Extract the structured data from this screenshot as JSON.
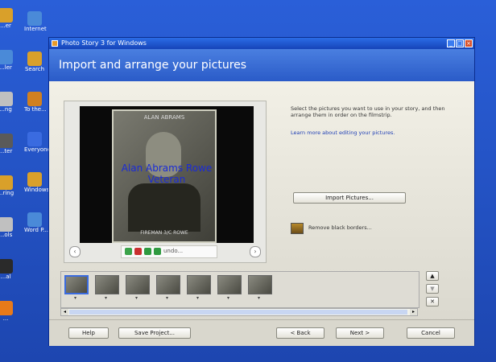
{
  "desktop": {
    "icons": [
      {
        "label": "...er",
        "color": "#d9a02a"
      },
      {
        "label": "...ler",
        "color": "#4a8ad8"
      },
      {
        "label": "...ng",
        "color": "#c0c0c0"
      },
      {
        "label": "...ter",
        "color": "#5a5a5a"
      },
      {
        "label": "...ring",
        "color": "#d9a02a"
      },
      {
        "label": "...ols",
        "color": "#c0c0c0"
      },
      {
        "label": "...al",
        "color": "#2a2a2a"
      },
      {
        "label": "...",
        "color": "#e87a1a"
      }
    ],
    "icons2": [
      {
        "label": "Internet",
        "color": "#4a8ad8"
      },
      {
        "label": "Search",
        "color": "#d9a02a"
      },
      {
        "label": "To the...",
        "color": "#d08020"
      },
      {
        "label": "Everyone",
        "color": "#3a6be0"
      },
      {
        "label": "Windows Movie M...",
        "color": "#d9a02a"
      },
      {
        "label": "Word P...",
        "color": "#4a8ad8"
      }
    ]
  },
  "window": {
    "title": "Photo Story 3 for Windows",
    "controls": {
      "minimize": "_",
      "maximize": "□",
      "close": "×"
    },
    "heading": "Import and arrange your pictures"
  },
  "preview": {
    "photo_top_text": "ALAN ABRAMS",
    "photo_bottom_text": "FIREMAN 3/C ROWE",
    "overlay_line1": "Alan Abrams Rowe",
    "overlay_line2": "Veteran",
    "prev_icon": "prev-arrow-icon",
    "next_icon": "next-arrow-icon",
    "undo_label": "undo..."
  },
  "right": {
    "description": "Select the pictures you want to use in your story, and then arrange them in order on the filmstrip.",
    "learn_link": "Learn more about editing your pictures.",
    "import_button": "Import Pictures...",
    "remove_borders": "Remove black borders..."
  },
  "filmstrip": {
    "count": 7,
    "selected_index": 0,
    "side_buttons": {
      "up": "▲",
      "down": "▼",
      "delete": "✕"
    }
  },
  "footer": {
    "help": "Help",
    "save_project": "Save Project...",
    "back": "< Back",
    "next": "Next >",
    "cancel": "Cancel"
  }
}
